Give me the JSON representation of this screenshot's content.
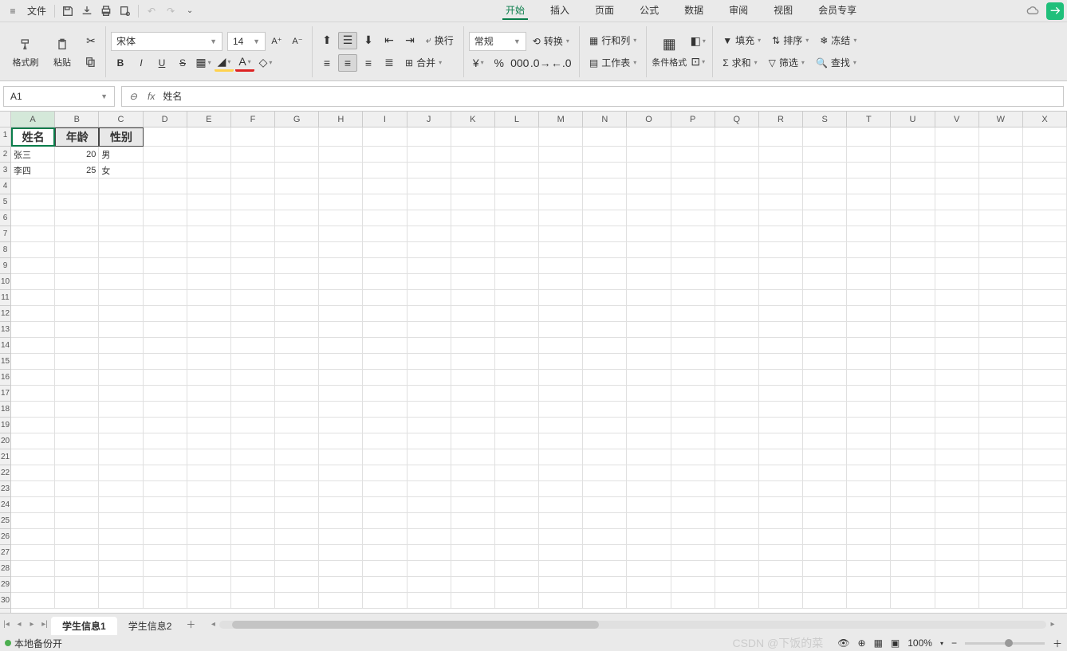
{
  "topbar": {
    "file": "文件"
  },
  "menu": {
    "items": [
      "开始",
      "插入",
      "页面",
      "公式",
      "数据",
      "审阅",
      "视图",
      "会员专享"
    ],
    "active": 0
  },
  "ribbon": {
    "format_painter": "格式刷",
    "paste": "粘贴",
    "font_name": "宋体",
    "font_size": "14",
    "wrap": "换行",
    "merge": "合并",
    "number_format": "常规",
    "convert": "转换",
    "rowcol": "行和列",
    "worksheet": "工作表",
    "cond_format": "条件格式",
    "fill": "填充",
    "sort": "排序",
    "freeze": "冻结",
    "sum": "求和",
    "filter": "筛选",
    "find": "查找"
  },
  "namebox": "A1",
  "formula_value": "姓名",
  "columns": [
    "A",
    "B",
    "C",
    "D",
    "E",
    "F",
    "G",
    "H",
    "I",
    "J",
    "K",
    "L",
    "M",
    "N",
    "O",
    "P",
    "Q",
    "R",
    "S",
    "T",
    "U",
    "V",
    "W",
    "X"
  ],
  "data": {
    "headers": [
      "姓名",
      "年龄",
      "性别"
    ],
    "rows": [
      {
        "name": "张三",
        "age": "20",
        "gender": "男"
      },
      {
        "name": "李四",
        "age": "25",
        "gender": "女"
      }
    ]
  },
  "sheets": {
    "tabs": [
      "学生信息1",
      "学生信息2"
    ],
    "active": 0
  },
  "status": {
    "backup": "本地备份开",
    "zoom": "100%",
    "watermark": "CSDN @下饭的菜"
  }
}
